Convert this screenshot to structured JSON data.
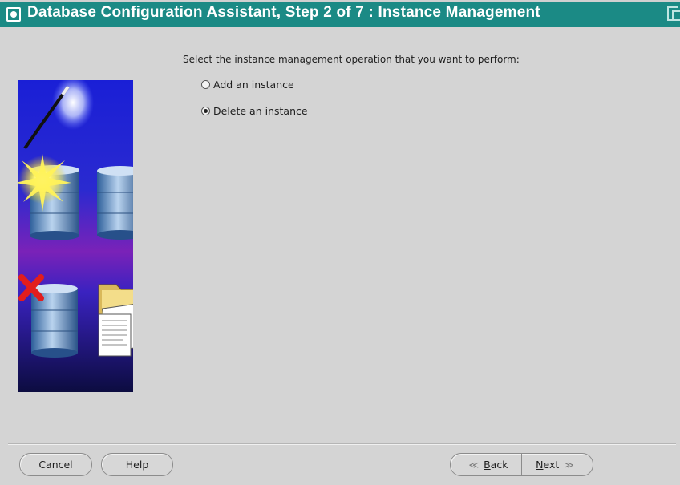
{
  "window": {
    "title": "Database Configuration Assistant, Step 2 of 7 : Instance Management"
  },
  "main": {
    "prompt": "Select the instance management operation that you want to perform:",
    "options": [
      {
        "label": "Add an instance",
        "selected": false
      },
      {
        "label": "Delete an instance",
        "selected": true
      }
    ]
  },
  "footer": {
    "cancel_label": "Cancel",
    "help_label": "Help",
    "back_label": "Back",
    "next_label": "Next",
    "back_arrow": "≪",
    "next_arrow": "≫"
  },
  "colors": {
    "titlebar": "#1b8a85",
    "background": "#d4d4d4"
  },
  "icons": [
    "window-menu-icon",
    "maximize-icon",
    "database-icon",
    "checkbox-icon",
    "delete-x-icon",
    "folder-icon",
    "magic-wand-icon"
  ]
}
